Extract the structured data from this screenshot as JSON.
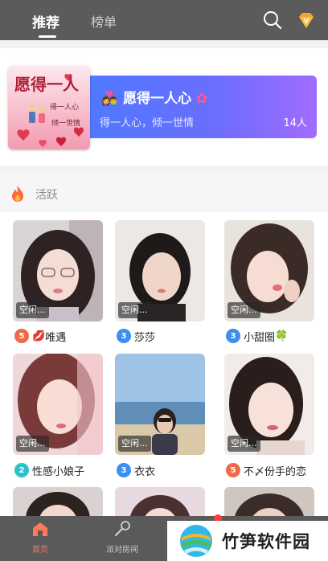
{
  "header": {
    "tabs": [
      {
        "label": "推荐",
        "active": true
      },
      {
        "label": "榜单",
        "active": false
      }
    ],
    "icons": [
      "search-icon",
      "vip-diamond-icon"
    ]
  },
  "featured_room": {
    "thumb_title": "愿得一人",
    "thumb_line1": "得一人心",
    "thumb_line2": "倾一世情",
    "title": "愿得一人心",
    "subtitle": "得一人心，倾一世情",
    "count": "14人"
  },
  "section": {
    "title": "活跃",
    "icon": "fire-icon"
  },
  "users": [
    {
      "status": "空闲...",
      "level": "5",
      "level_color": "#f06a4a",
      "name": "唯遇",
      "emoji_before": "💋",
      "emoji_after": ""
    },
    {
      "status": "空闲...",
      "level": "3",
      "level_color": "#3d8ef0",
      "name": "莎莎",
      "emoji_before": "",
      "emoji_after": ""
    },
    {
      "status": "空闲...",
      "level": "3",
      "level_color": "#3d8ef0",
      "name": "小甜圈",
      "emoji_before": "",
      "emoji_after": "🍀"
    },
    {
      "status": "空闲...",
      "level": "2",
      "level_color": "#2fc0c9",
      "name": "性感小娘子",
      "emoji_before": "",
      "emoji_after": ""
    },
    {
      "status": "空闲...",
      "level": "3",
      "level_color": "#3d8ef0",
      "name": "衣衣",
      "emoji_before": "",
      "emoji_after": ""
    },
    {
      "status": "空闲...",
      "level": "5",
      "level_color": "#f06a4a",
      "name": "不〆份手的恋",
      "emoji_before": "",
      "emoji_after": ""
    }
  ],
  "bottom_nav": [
    {
      "label": "首页",
      "icon": "home-icon",
      "active": true,
      "color": "#ff7a5a"
    },
    {
      "label": "派对房间",
      "icon": "microphone-icon",
      "active": false,
      "color": "#d0d0d0"
    }
  ],
  "watermark": {
    "text": "竹笋软件园"
  },
  "colors": {
    "topbar": "#5b5b5b",
    "accent": "#ff7a5a",
    "banner_start": "#4f79ff",
    "banner_end": "#a06cff"
  }
}
